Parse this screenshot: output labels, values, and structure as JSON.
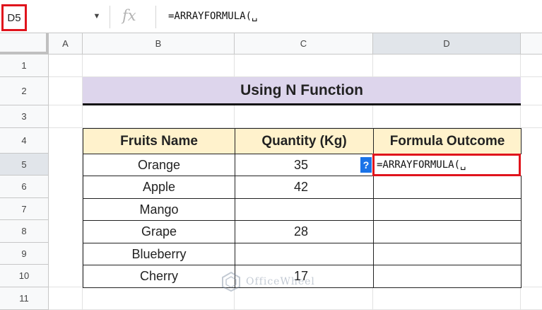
{
  "formula_bar": {
    "name_box": "D5",
    "fx_label": "fx",
    "formula": "=ARRAYFORMULA(␣"
  },
  "columns": [
    "A",
    "B",
    "C",
    "D"
  ],
  "rows": [
    "1",
    "2",
    "3",
    "4",
    "5",
    "6",
    "7",
    "8",
    "9",
    "10",
    "11"
  ],
  "sheet": {
    "title": "Using N Function",
    "headers": [
      "Fruits Name",
      "Quantity (Kg)",
      "Formula Outcome"
    ],
    "data": [
      {
        "fruit": "Orange",
        "qty": "35",
        "outcome": "=ARRAYFORMULA(␣"
      },
      {
        "fruit": "Apple",
        "qty": "42",
        "outcome": ""
      },
      {
        "fruit": "Mango",
        "qty": "",
        "outcome": ""
      },
      {
        "fruit": "Grape",
        "qty": "28",
        "outcome": ""
      },
      {
        "fruit": "Blueberry",
        "qty": "",
        "outcome": ""
      },
      {
        "fruit": "Cherry",
        "qty": "17",
        "outcome": ""
      }
    ],
    "help_chip": "?"
  },
  "watermark": "OfficeWheel",
  "colors": {
    "selection_border": "#e0141c",
    "title_fill": "#ddd5ec",
    "header_fill": "#fff2cc",
    "chip": "#1a73e8"
  }
}
